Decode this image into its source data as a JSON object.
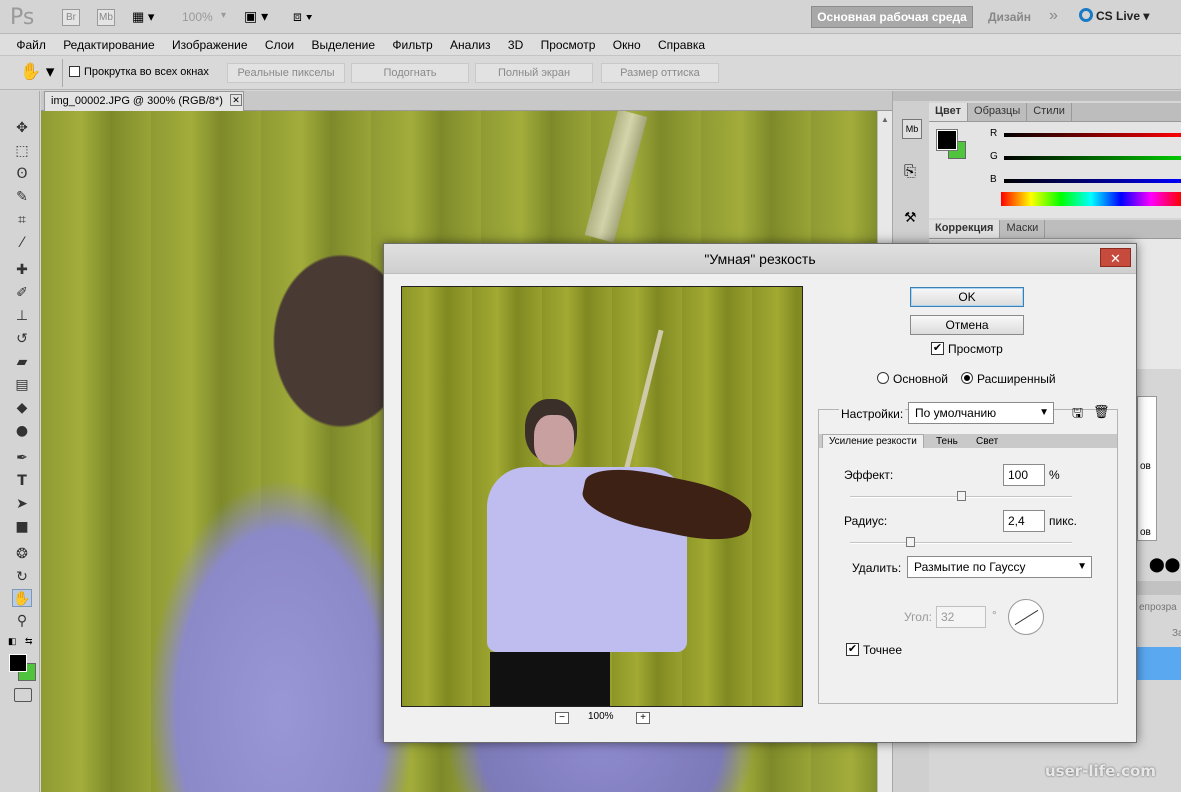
{
  "app": {
    "logo": "Ps",
    "bridge_label": "Br",
    "minibridge_label": "Mb",
    "zoom_level": "100%",
    "workspace_essentials": "Основная рабочая среда",
    "workspace_design": "Дизайн",
    "more_icon": "»",
    "cs_live": "CS Live"
  },
  "menu": [
    "Файл",
    "Редактирование",
    "Изображение",
    "Слои",
    "Выделение",
    "Фильтр",
    "Анализ",
    "3D",
    "Просмотр",
    "Окно",
    "Справка"
  ],
  "options": {
    "scroll_all_label": "Прокрутка во всех окнах",
    "actual_pixels": "Реальные пикселы",
    "fit_screen": "Подогнать",
    "full_screen": "Полный экран",
    "print_size": "Размер оттиска"
  },
  "document": {
    "tab_title": "img_00002.JPG @ 300% (RGB/8*)",
    "close_icon": "close-icon"
  },
  "tools": [
    "move-icon",
    "marquee-icon",
    "lasso-icon",
    "quick-select-icon",
    "crop-icon",
    "eyedropper-icon",
    "healing-icon",
    "brush-icon",
    "stamp-icon",
    "history-brush-icon",
    "eraser-icon",
    "gradient-icon",
    "blur-icon",
    "dodge-icon",
    "pen-icon",
    "type-icon",
    "path-select-icon",
    "shape-icon",
    "3d-rotate-icon",
    "3d-orbit-icon",
    "hand-icon",
    "zoom-icon"
  ],
  "colors": {
    "foreground": "#000000",
    "background": "#4fc43c",
    "accent_blue": "#5aa8f0",
    "close_red": "#c74b3c"
  },
  "panels": {
    "color_tabs": [
      "Цвет",
      "Образцы",
      "Стили"
    ],
    "channels": [
      "R",
      "G",
      "B"
    ],
    "adjust_tabs": [
      "Коррекция",
      "Маски"
    ],
    "layers_fragment": [
      "ов",
      "ов"
    ],
    "opacity_fragment": "епрозра",
    "label_fragment": "За"
  },
  "dialog": {
    "title": "\"Умная\" резкость",
    "close_label": "✕",
    "ok": "OK",
    "cancel": "Отмена",
    "preview_label": "Просмотр",
    "preview_checked": true,
    "mode_basic": "Основной",
    "mode_advanced": "Расширенный",
    "mode_selected": "advanced",
    "settings_label": "Настройки:",
    "settings_value": "По умолчанию",
    "tabs": [
      "Усиление резкости",
      "Тень",
      "Свет"
    ],
    "amount_label": "Эффект:",
    "amount_value": "100",
    "amount_unit": "%",
    "amount_fraction": 0.5,
    "radius_label": "Радиус:",
    "radius_value": "2,4",
    "radius_unit": "пикс.",
    "radius_fraction": 0.27,
    "remove_label": "Удалить:",
    "remove_value": "Размытие по Гауссу",
    "angle_label": "Угол:",
    "angle_value": "32",
    "angle_unit": "°",
    "more_accurate_label": "Точнее",
    "more_accurate_checked": true,
    "preview_zoom": "100%",
    "zoom_out": "−",
    "zoom_in": "+"
  },
  "watermark": "user-life.com"
}
